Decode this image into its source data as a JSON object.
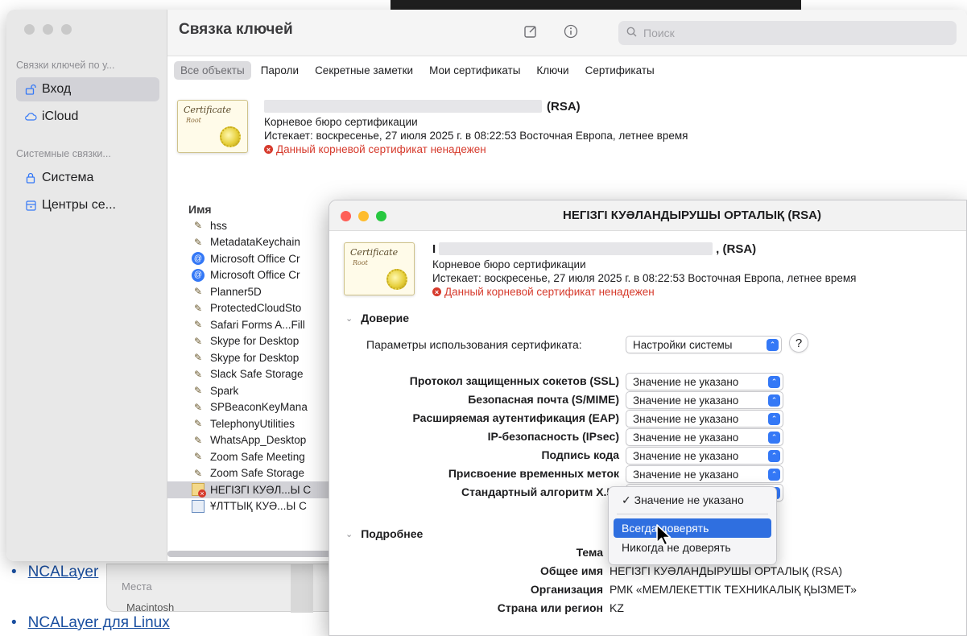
{
  "web": {
    "links": [
      "NCALayer",
      "NCALayer для Linux"
    ]
  },
  "finder": {
    "places_label": "Места",
    "disk_label": "Macintosh"
  },
  "keychain": {
    "title": "Связка ключей",
    "search_placeholder": "Поиск",
    "sidebar": {
      "user_header": "Связки ключей по у...",
      "user_items": [
        {
          "label": "Вход",
          "icon": "lock-open-icon"
        },
        {
          "label": "iCloud",
          "icon": "cloud-icon"
        }
      ],
      "system_header": "Системные связки...",
      "system_items": [
        {
          "label": "Система",
          "icon": "lock-icon"
        },
        {
          "label": "Центры се...",
          "icon": "cabinet-icon"
        }
      ]
    },
    "tabs": [
      "Все объекты",
      "Пароли",
      "Секретные заметки",
      "Мои сертификаты",
      "Ключи",
      "Сертификаты"
    ],
    "cert_summary": {
      "name_suffix": "(RSA)",
      "type": "Корневое бюро сертификации",
      "expires": "Истекает: воскресенье, 27 июля 2025 г. в 08:22:53 Восточная Европа, летнее время",
      "warning": "Данный корневой сертификат ненадежен"
    },
    "list_header": "Имя",
    "list_items": [
      {
        "label": "hss",
        "icon": "pen"
      },
      {
        "label": "MetadataKeychain",
        "icon": "pen"
      },
      {
        "label": "Microsoft Office Cr",
        "icon": "globe"
      },
      {
        "label": "Microsoft Office Cr",
        "icon": "globe"
      },
      {
        "label": "Planner5D",
        "icon": "pen"
      },
      {
        "label": "ProtectedCloudSto",
        "icon": "pen"
      },
      {
        "label": "Safari Forms A...Fill",
        "icon": "pen"
      },
      {
        "label": "Skype for Desktop",
        "icon": "pen"
      },
      {
        "label": "Skype for Desktop",
        "icon": "pen"
      },
      {
        "label": "Slack Safe Storage",
        "icon": "pen"
      },
      {
        "label": "Spark",
        "icon": "pen"
      },
      {
        "label": "SPBeaconKeyMana",
        "icon": "pen"
      },
      {
        "label": "TelephonyUtilities",
        "icon": "pen"
      },
      {
        "label": "WhatsApp_Desktop",
        "icon": "pen"
      },
      {
        "label": "Zoom Safe Meeting",
        "icon": "pen"
      },
      {
        "label": "Zoom Safe Storage",
        "icon": "pen"
      },
      {
        "label": "НЕГІЗГІ КУӘЛ...Ы С",
        "icon": "certbad"
      },
      {
        "label": "ҰЛТТЫҚ КУӘ...Ы С",
        "icon": "certok"
      }
    ],
    "selected_index": 16
  },
  "dialog": {
    "title": "НЕГІЗГІ КУӘЛАНДЫРУШЫ ОРТАЛЫҚ (RSA)",
    "cert_prefix": "I",
    "cert_suffix": ", (RSA)",
    "type": "Корневое бюро сертификации",
    "expires": "Истекает: воскресенье, 27 июля 2025 г. в 08:22:53 Восточная Европа, летнее время",
    "warning": "Данный корневой сертификат ненадежен",
    "trust_section": "Доверие",
    "usage_label": "Параметры использования сертификата:",
    "usage_value": "Настройки системы",
    "help_label": "?",
    "trust_rows": [
      {
        "label": "Протокол защищенных сокетов (SSL)",
        "value": "Значение не указано"
      },
      {
        "label": "Безопасная почта (S/MIME)",
        "value": "Значение не указано"
      },
      {
        "label": "Расширяемая аутентификация (EAP)",
        "value": "Значение не указано"
      },
      {
        "label": "IP-безопасность (IPsec)",
        "value": "Значение не указано"
      },
      {
        "label": "Подпись кода",
        "value": "Значение не указано"
      },
      {
        "label": "Присвоение временных меток",
        "value": "Значение не указано"
      },
      {
        "label": "Стандартный алгоритм X.50",
        "value": ""
      }
    ],
    "details_section": "Подробнее",
    "details": [
      {
        "label": "Тема",
        "value": ""
      },
      {
        "label": "Общее имя",
        "value": "НЕГІЗГІ КУӘЛАНДЫРУШЫ ОРТАЛЫҚ (RSA)"
      },
      {
        "label": "Организация",
        "value": "РМК «МЕМЛЕКЕТТІК ТЕХНИКАЛЫҚ ҚЫЗМЕТ»"
      },
      {
        "label": "Страна или регион",
        "value": "KZ"
      }
    ]
  },
  "menu": {
    "items": [
      "✓ Значение не указано",
      "Всегда доверять",
      "Никогда не доверять"
    ],
    "highlighted_index": 1
  },
  "colors": {
    "accent": "#3478f6",
    "warning": "#d63a2c",
    "close": "#fe5f57",
    "minimize": "#febc2e",
    "zoom": "#28c840"
  }
}
